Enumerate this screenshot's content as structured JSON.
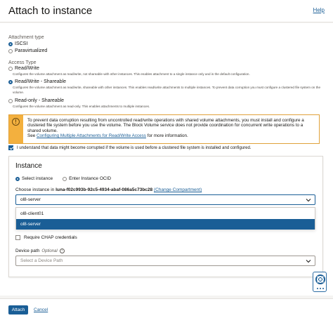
{
  "header": {
    "title": "Attach to instance",
    "help_label": "Help"
  },
  "attachment_type": {
    "label": "Attachment type",
    "options": [
      {
        "label": "ISCSI",
        "selected": true
      },
      {
        "label": "Paravirtualized",
        "selected": false
      }
    ]
  },
  "access_type": {
    "label": "Access Type",
    "options": [
      {
        "label": "Read/Write",
        "selected": false,
        "description": "Configures the volume attachment as read/write, not shareable with other instances. This enables attachment to a single instance only and is the default configuration."
      },
      {
        "label": "Read/Write - Shareable",
        "selected": true,
        "description": "Configures the volume attachment as read/write, shareable with other instances. This enables read/write attachments to multiple instances. To prevent data corruption you must configure a clustered file system on the volume."
      },
      {
        "label": "Read-only - Shareable",
        "selected": false,
        "description": "Configures the volume attachment as read-only. This enables attachments to multiple instances."
      }
    ]
  },
  "warning": {
    "text": "To prevent data corruption resulting from uncontrolled read/write operations with shared volume attachments, you must install and configure a clustered file system before you use the volume. The Block Volume service does not provide coordination for concurrent write operations to a shared volume.",
    "see_prefix": "See",
    "link_text": "Configuring Multiple Attachments for Read/Write Access",
    "see_suffix": "for more information."
  },
  "acknowledge": {
    "label": "I understand that data might become corrupted if the volume is used before a clustered file system is installed and configured.",
    "checked": true
  },
  "instance": {
    "title": "Instance",
    "mode_options": [
      {
        "label": "Select instance",
        "selected": true
      },
      {
        "label": "Enter Instance OCID",
        "selected": false
      }
    ],
    "choose_prefix": "Choose instance in",
    "compartment_name": "luna-f02c993b-92c5-4934-abaf-086a5c73bc28",
    "change_compartment_label": "(Change Compartment)",
    "selected_value": "ol8-server",
    "dropdown_options": [
      {
        "label": "ol8-client01",
        "selected": false
      },
      {
        "label": "ol8-server",
        "selected": true
      }
    ],
    "chap_label": "Require CHAP credentials",
    "chap_checked": false,
    "device_path_label": "Device path",
    "device_path_optional": "Optional",
    "device_path_placeholder": "Select a Device Path"
  },
  "footer": {
    "attach_label": "Attach",
    "cancel_label": "Cancel"
  },
  "colors": {
    "accent": "#1a5e96",
    "warning": "#f3b03e"
  }
}
